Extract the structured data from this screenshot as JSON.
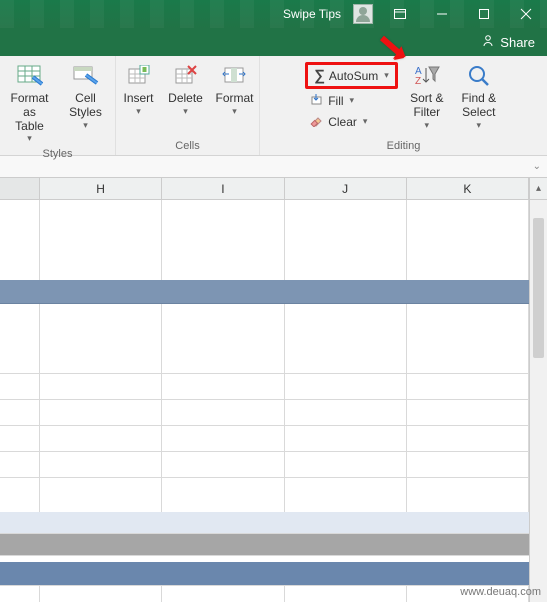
{
  "titlebar": {
    "title": "Swipe Tips"
  },
  "sharebar": {
    "share_label": "Share"
  },
  "ribbon": {
    "styles_group": {
      "label": "Styles",
      "format_as_table": "Format as\nTable",
      "cell_styles": "Cell\nStyles"
    },
    "cells_group": {
      "label": "Cells",
      "insert": "Insert",
      "delete": "Delete",
      "format": "Format"
    },
    "editing_group": {
      "label": "Editing",
      "autosum": "AutoSum",
      "fill": "Fill",
      "clear": "Clear",
      "sort_filter": "Sort &\nFilter",
      "find_select": "Find &\nSelect"
    }
  },
  "columns": {
    "h": "H",
    "i": "I",
    "j": "J",
    "k": "K"
  },
  "watermark": "www.deuaq.com"
}
